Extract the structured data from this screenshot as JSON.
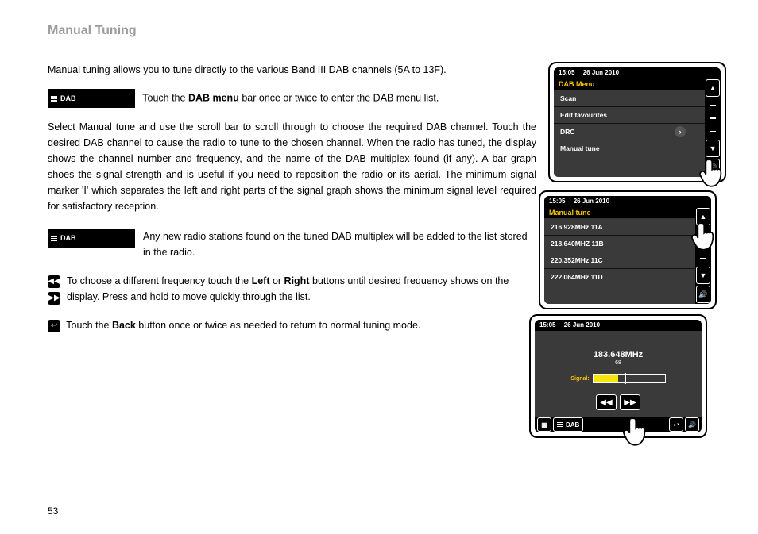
{
  "page": {
    "number": "53",
    "title": "Manual Tuning"
  },
  "text": {
    "intro": "Manual tuning allows you to tune directly to the various Band III DAB channels (5A to 13F).",
    "dab_chip": "DAB",
    "touch_menu_pre": "Touch the ",
    "touch_menu_bold": "DAB menu",
    "touch_menu_post": " bar once or twice to enter the DAB menu list.",
    "para2": "Select Manual tune and use the scroll bar to scroll through to choose the required DAB channel. Touch the desired DAB channel to cause the radio to tune to the chosen channel. When the radio has tuned, the display shows the channel number and frequency, and the name of the DAB multiplex found (if any). A bar graph shoes the signal strength and is useful if you need to reposition the radio or its aerial. The minimum signal marker 'I' which separates the left and right parts of the signal graph shows the minimum signal level required for satisfactory reception.",
    "new_stations": "Any new radio stations found on the tuned DAB multiplex will be added to the list stored in the radio.",
    "freq_pre": "To choose a different frequency touch the ",
    "freq_left": "Left",
    "freq_mid": " or ",
    "freq_right": "Right",
    "freq_post": " buttons until desired frequency shows on the display. Press and hold to move quickly through the list.",
    "back_pre": "Touch the ",
    "back_bold": "Back",
    "back_post": " button once or twice as needed to return to normal tuning mode."
  },
  "status": {
    "time": "15:05",
    "date": "26 Jun 2010"
  },
  "screen1": {
    "title": "DAB Menu",
    "items": [
      "Scan",
      "Edit favourites",
      "DRC",
      "Manual tune"
    ]
  },
  "screen2": {
    "title": "Manual tune",
    "items": [
      "216.928MHz 11A",
      "218.640MHZ 11B",
      "220.352MHz 11C",
      "222.064MHz 11D"
    ]
  },
  "screen3": {
    "freq": "183.648MHz",
    "sub": "68",
    "signal_label": "Signal:",
    "signal_percent": 35,
    "bottom_label": "DAB"
  }
}
